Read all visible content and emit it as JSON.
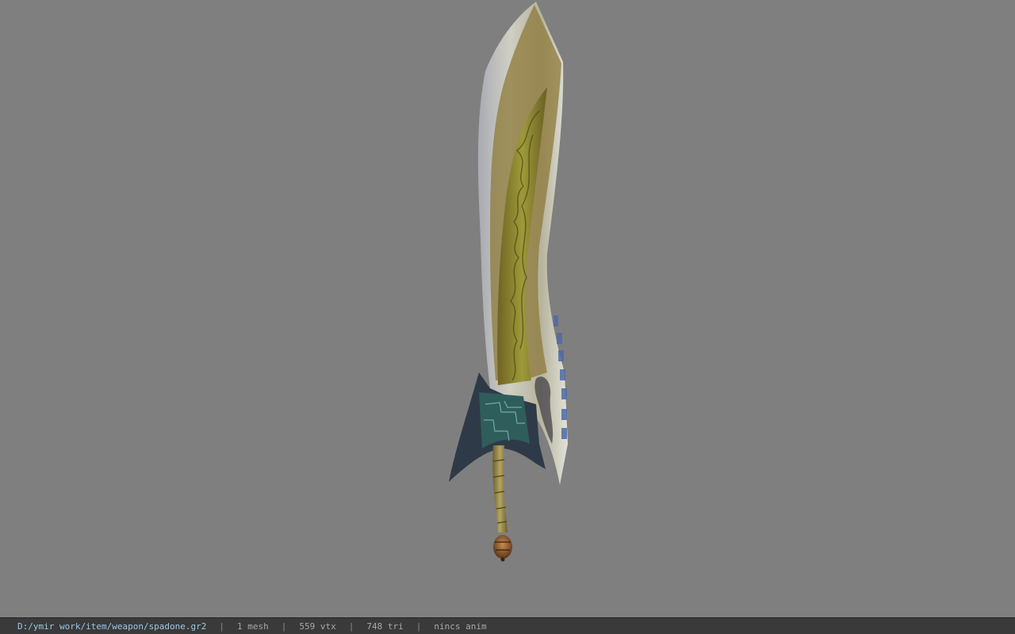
{
  "viewer": {
    "background_color": "#7f7f7f",
    "model_icon": "sword-model-icon"
  },
  "statusbar": {
    "file_path": "D:/ymir work/item/weapon/spadone.gr2",
    "separator": "|",
    "mesh_count": "1 mesh",
    "vertex_count": "559 vtx",
    "triangle_count": "748 tri",
    "anim_status": "nincs anim"
  }
}
